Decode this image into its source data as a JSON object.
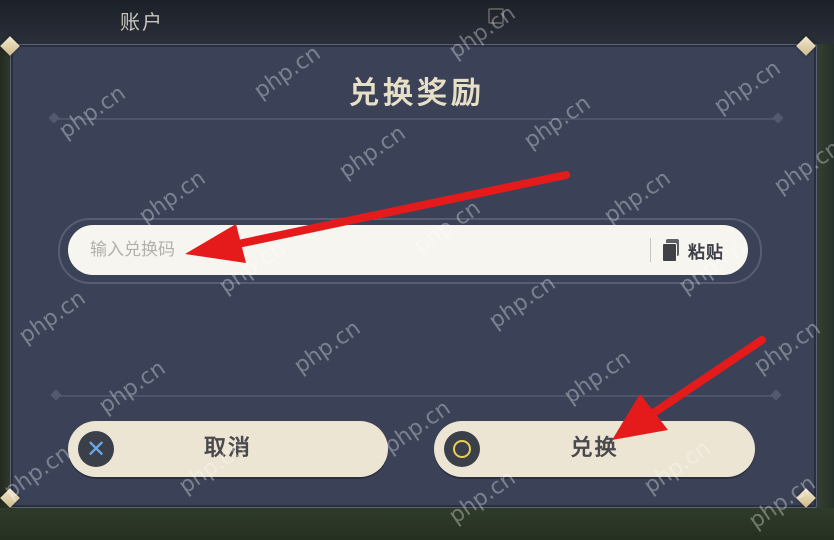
{
  "background": {
    "tab_label": "账户"
  },
  "dialog": {
    "title": "兑换奖励",
    "input": {
      "placeholder": "输入兑换码",
      "value": ""
    },
    "paste_label": "粘贴",
    "cancel_label": "取消",
    "confirm_label": "兑换"
  },
  "watermark_text": "php.cn",
  "colors": {
    "dialog_bg": "#3b4258",
    "title": "#e8dfc7",
    "button_bg": "#ece5d3",
    "cancel_icon": "#6aa7e6",
    "confirm_icon": "#e7cf55",
    "arrow": "#e51b1b"
  },
  "icons": [
    "cancel-x-icon",
    "confirm-circle-icon",
    "paste-clipboard-icon",
    "corner-diamond-icon"
  ]
}
